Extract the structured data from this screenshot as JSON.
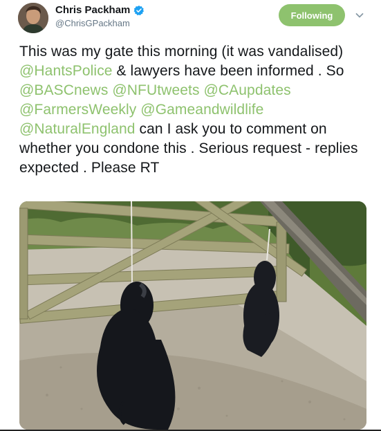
{
  "tweet": {
    "display_name": "Chris Packham",
    "handle": "@ChrisGPackham",
    "follow_label": "Following",
    "text_segments": [
      {
        "t": "This was my gate this morning (it was vandalised) ",
        "m": false
      },
      {
        "t": "@HantsPolice",
        "m": true
      },
      {
        "t": " & lawyers have been informed . So ",
        "m": false
      },
      {
        "t": "@BASCnews",
        "m": true
      },
      {
        "t": " ",
        "m": false
      },
      {
        "t": "@NFUtweets",
        "m": true
      },
      {
        "t": " ",
        "m": false
      },
      {
        "t": "@CAupdates",
        "m": true
      },
      {
        "t": " ",
        "m": false
      },
      {
        "t": "@FarmersWeekly",
        "m": true
      },
      {
        "t": " ",
        "m": false
      },
      {
        "t": "@Gameandwildlife",
        "m": true
      },
      {
        "t": " ",
        "m": false
      },
      {
        "t": "@NaturalEngland",
        "m": true
      },
      {
        "t": " can I ask you to comment on whether you condone this . Serious request - replies expected . Please RT",
        "m": false
      }
    ]
  },
  "colors": {
    "accent": "#8ec26e",
    "verified": "#1da1f2",
    "handle": "#657786"
  },
  "icons": {
    "verified": "verified-badge-icon",
    "caret": "chevron-down-icon"
  }
}
